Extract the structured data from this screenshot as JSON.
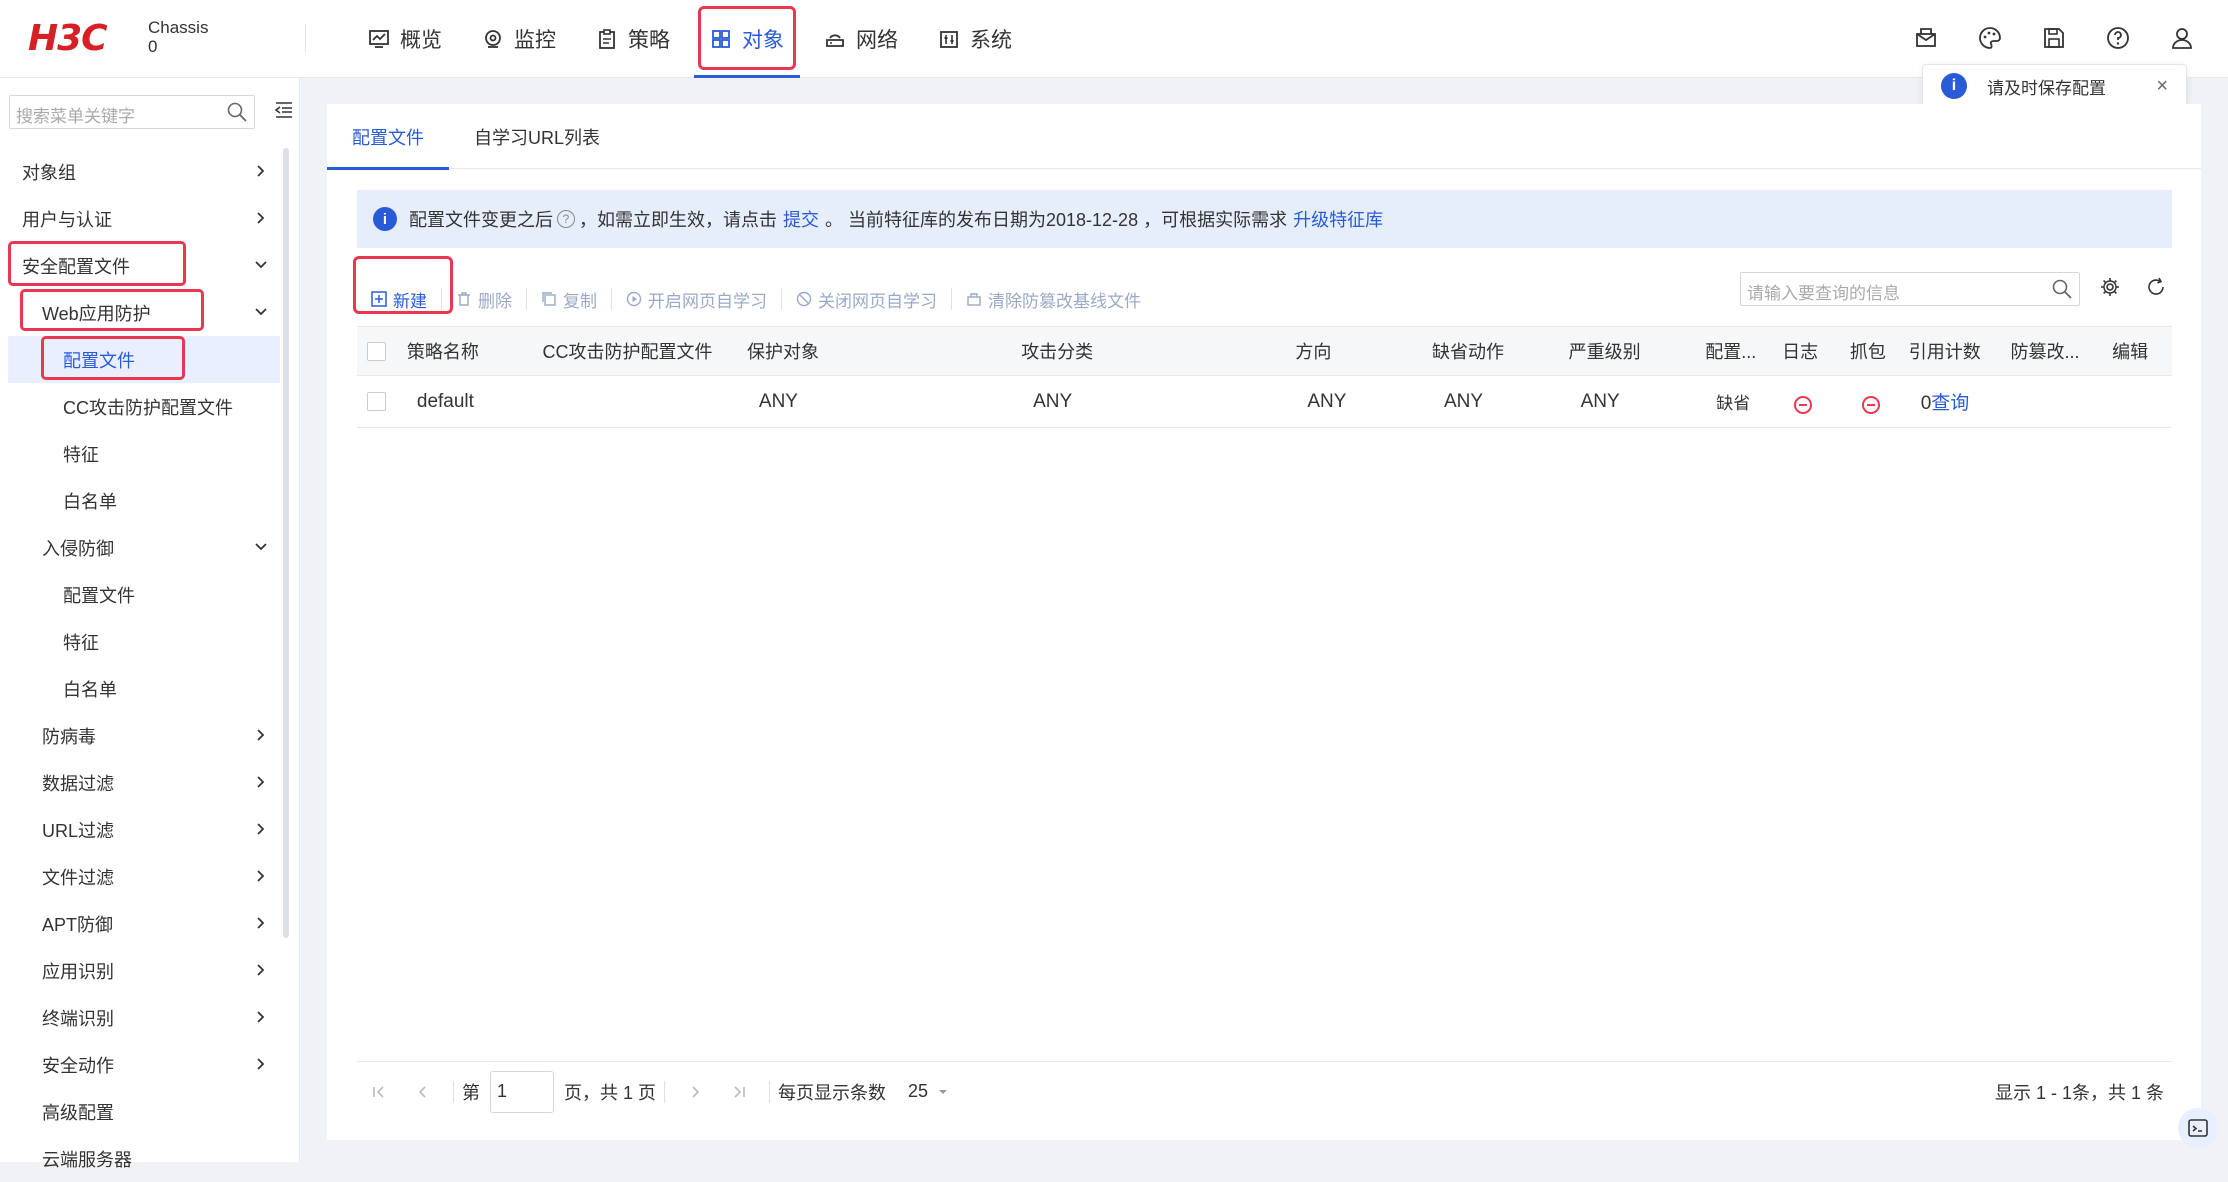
{
  "brand": {
    "logo": "H3C",
    "device_line1": "Chassis",
    "device_line2": "0"
  },
  "nav": [
    {
      "label": "概览",
      "icon": "overview-icon"
    },
    {
      "label": "监控",
      "icon": "monitor-icon"
    },
    {
      "label": "策略",
      "icon": "policy-icon"
    },
    {
      "label": "对象",
      "icon": "object-icon",
      "active": true
    },
    {
      "label": "网络",
      "icon": "network-icon"
    },
    {
      "label": "系统",
      "icon": "system-icon"
    }
  ],
  "toast": {
    "text": "请及时保存配置",
    "close": "×"
  },
  "sidebar": {
    "search_placeholder": "搜索菜单关键字",
    "items": [
      {
        "label": "对象组"
      },
      {
        "label": "用户与认证"
      },
      {
        "label": "安全配置文件"
      },
      {
        "label": "Web应用防护"
      },
      {
        "label": "配置文件"
      },
      {
        "label": "CC攻击防护配置文件"
      },
      {
        "label": "特征"
      },
      {
        "label": "白名单"
      },
      {
        "label": "入侵防御"
      },
      {
        "label": "配置文件"
      },
      {
        "label": "特征"
      },
      {
        "label": "白名单"
      },
      {
        "label": "防病毒"
      },
      {
        "label": "数据过滤"
      },
      {
        "label": "URL过滤"
      },
      {
        "label": "文件过滤"
      },
      {
        "label": "APT防御"
      },
      {
        "label": "应用识别"
      },
      {
        "label": "终端识别"
      },
      {
        "label": "安全动作"
      },
      {
        "label": "高级配置"
      },
      {
        "label": "云端服务器"
      }
    ]
  },
  "tabs": [
    {
      "label": "配置文件"
    },
    {
      "label": "自学习URL列表"
    }
  ],
  "notice": {
    "text1": "配置文件变更之后",
    "help": "?",
    "text2": "，如需立即生效，请点击",
    "link1": "提交",
    "text3": "。 当前特征库的发布日期为2018-12-28 ，可根据实际需求",
    "link2": "升级特征库"
  },
  "toolbar": {
    "new": "新建",
    "delete": "删除",
    "copy": "复制",
    "enable_learning": "开启网页自学习",
    "disable_learning": "关闭网页自学习",
    "clear_baseline": "清除防篡改基线文件",
    "search_placeholder": "请输入要查询的信息"
  },
  "table": {
    "headers": [
      "策略名称",
      "CC攻击防护配置文件",
      "保护对象",
      "攻击分类",
      "方向",
      "缺省动作",
      "严重级别",
      "配置...",
      "日志",
      "抓包",
      "引用计数",
      "防篡改...",
      "编辑"
    ],
    "rows": [
      {
        "name": "default",
        "cc": "",
        "protect": "ANY",
        "attack": "ANY",
        "direction": "ANY",
        "default_action": "ANY",
        "severity": "ANY",
        "config": "缺省",
        "log": "off",
        "capture": "off",
        "ref_count": "0",
        "ref_link": "查询",
        "tamper": "",
        "edit": ""
      }
    ]
  },
  "pagination": {
    "page_prefix": "第",
    "page_value": "1",
    "page_suffix": "页，共 1 页",
    "page_size_label": "每页显示条数",
    "page_size": "25",
    "summary": "显示 1 - 1条，共 1 条"
  },
  "colors": {
    "accent": "#2a5bd7",
    "highlight": "#e8384f",
    "brand": "#d71f26"
  }
}
